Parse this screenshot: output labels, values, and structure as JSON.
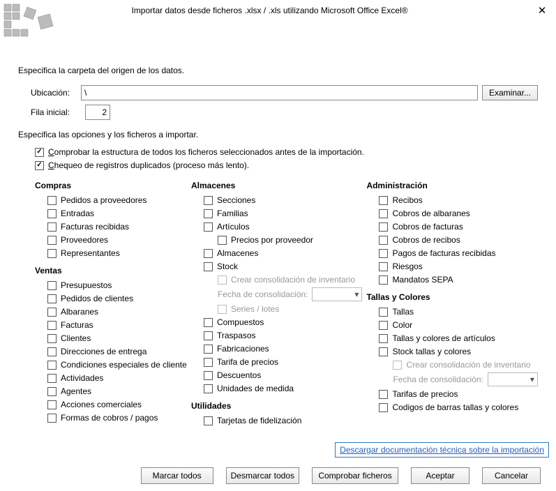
{
  "title": "Importar datos desde ficheros .xlsx / .xls utilizando Microsoft Office Excel®",
  "intro1": "Especifica la carpeta del origen de los datos.",
  "loc_label": "Ubicación:",
  "loc_value": "\\",
  "browse": "Examinar...",
  "fila_label": "Fila inicial:",
  "fila_value": "2",
  "intro2": "Especifica las opciones y los ficheros a importar.",
  "opt_check_struct_pre": "C",
  "opt_check_struct_rest": "omprobar la estructura de todos los ficheros seleccionados antes de la importación.",
  "opt_dup_pre": "C",
  "opt_dup_rest": "hequeo de registros duplicados (proceso más lento).",
  "col1": {
    "g1_title": "Compras",
    "g1_items": [
      "Pedidos a proveedores",
      "Entradas",
      "Facturas recibidas",
      "Proveedores",
      "Representantes"
    ],
    "g2_title": "Ventas",
    "g2_items": [
      "Presupuestos",
      "Pedidos de clientes",
      "Albaranes",
      "Facturas",
      "Clientes",
      "Direcciones de entrega",
      "Condiciones especiales de cliente",
      "Actividades",
      "Agentes",
      "Acciones comerciales",
      "Formas de cobros / pagos"
    ]
  },
  "col2": {
    "g1_title": "Almacenes",
    "g1_items_top": [
      "Secciones",
      "Familias",
      "Artículos"
    ],
    "sub_precios": "Precios por proveedor",
    "g1_items_mid": [
      "Almacenes",
      "Stock"
    ],
    "sub_crear1": "Crear consolidación de inventario",
    "sub_fecha1": "Fecha de consolidación:",
    "sub_series": "Series / lotes",
    "g1_items_bot": [
      "Compuestos",
      "Traspasos",
      "Fabricaciones",
      "Tarifa de precios",
      "Descuentos",
      "Unidades de medida"
    ],
    "g2_title": "Utilidades",
    "g2_items": [
      "Tarjetas de fidelización"
    ]
  },
  "col3": {
    "g1_title": "Administración",
    "g1_items": [
      "Recibos",
      "Cobros de albaranes",
      "Cobros de facturas",
      "Cobros de recibos",
      "Pagos de facturas recibidas",
      "Riesgos",
      "Mandatos SEPA"
    ],
    "g2_title": "Tallas y Colores",
    "g2_items_top": [
      "Tallas",
      "Color",
      "Tallas y colores de artículos",
      "Stock tallas y colores"
    ],
    "sub_crear2": "Crear consolidación de inventario",
    "sub_fecha2": "Fecha de consolidación:",
    "g2_items_bot": [
      "Tarifas de precios",
      "Codigos de barras tallas y colores"
    ]
  },
  "link": "Descargar documentación técnica sobre la importación",
  "btns": {
    "marcar": "Marcar todos",
    "desmarcar": "Desmarcar todos",
    "comprobar": "Comprobar ficheros",
    "aceptar": "Aceptar",
    "cancelar": "Cancelar"
  }
}
